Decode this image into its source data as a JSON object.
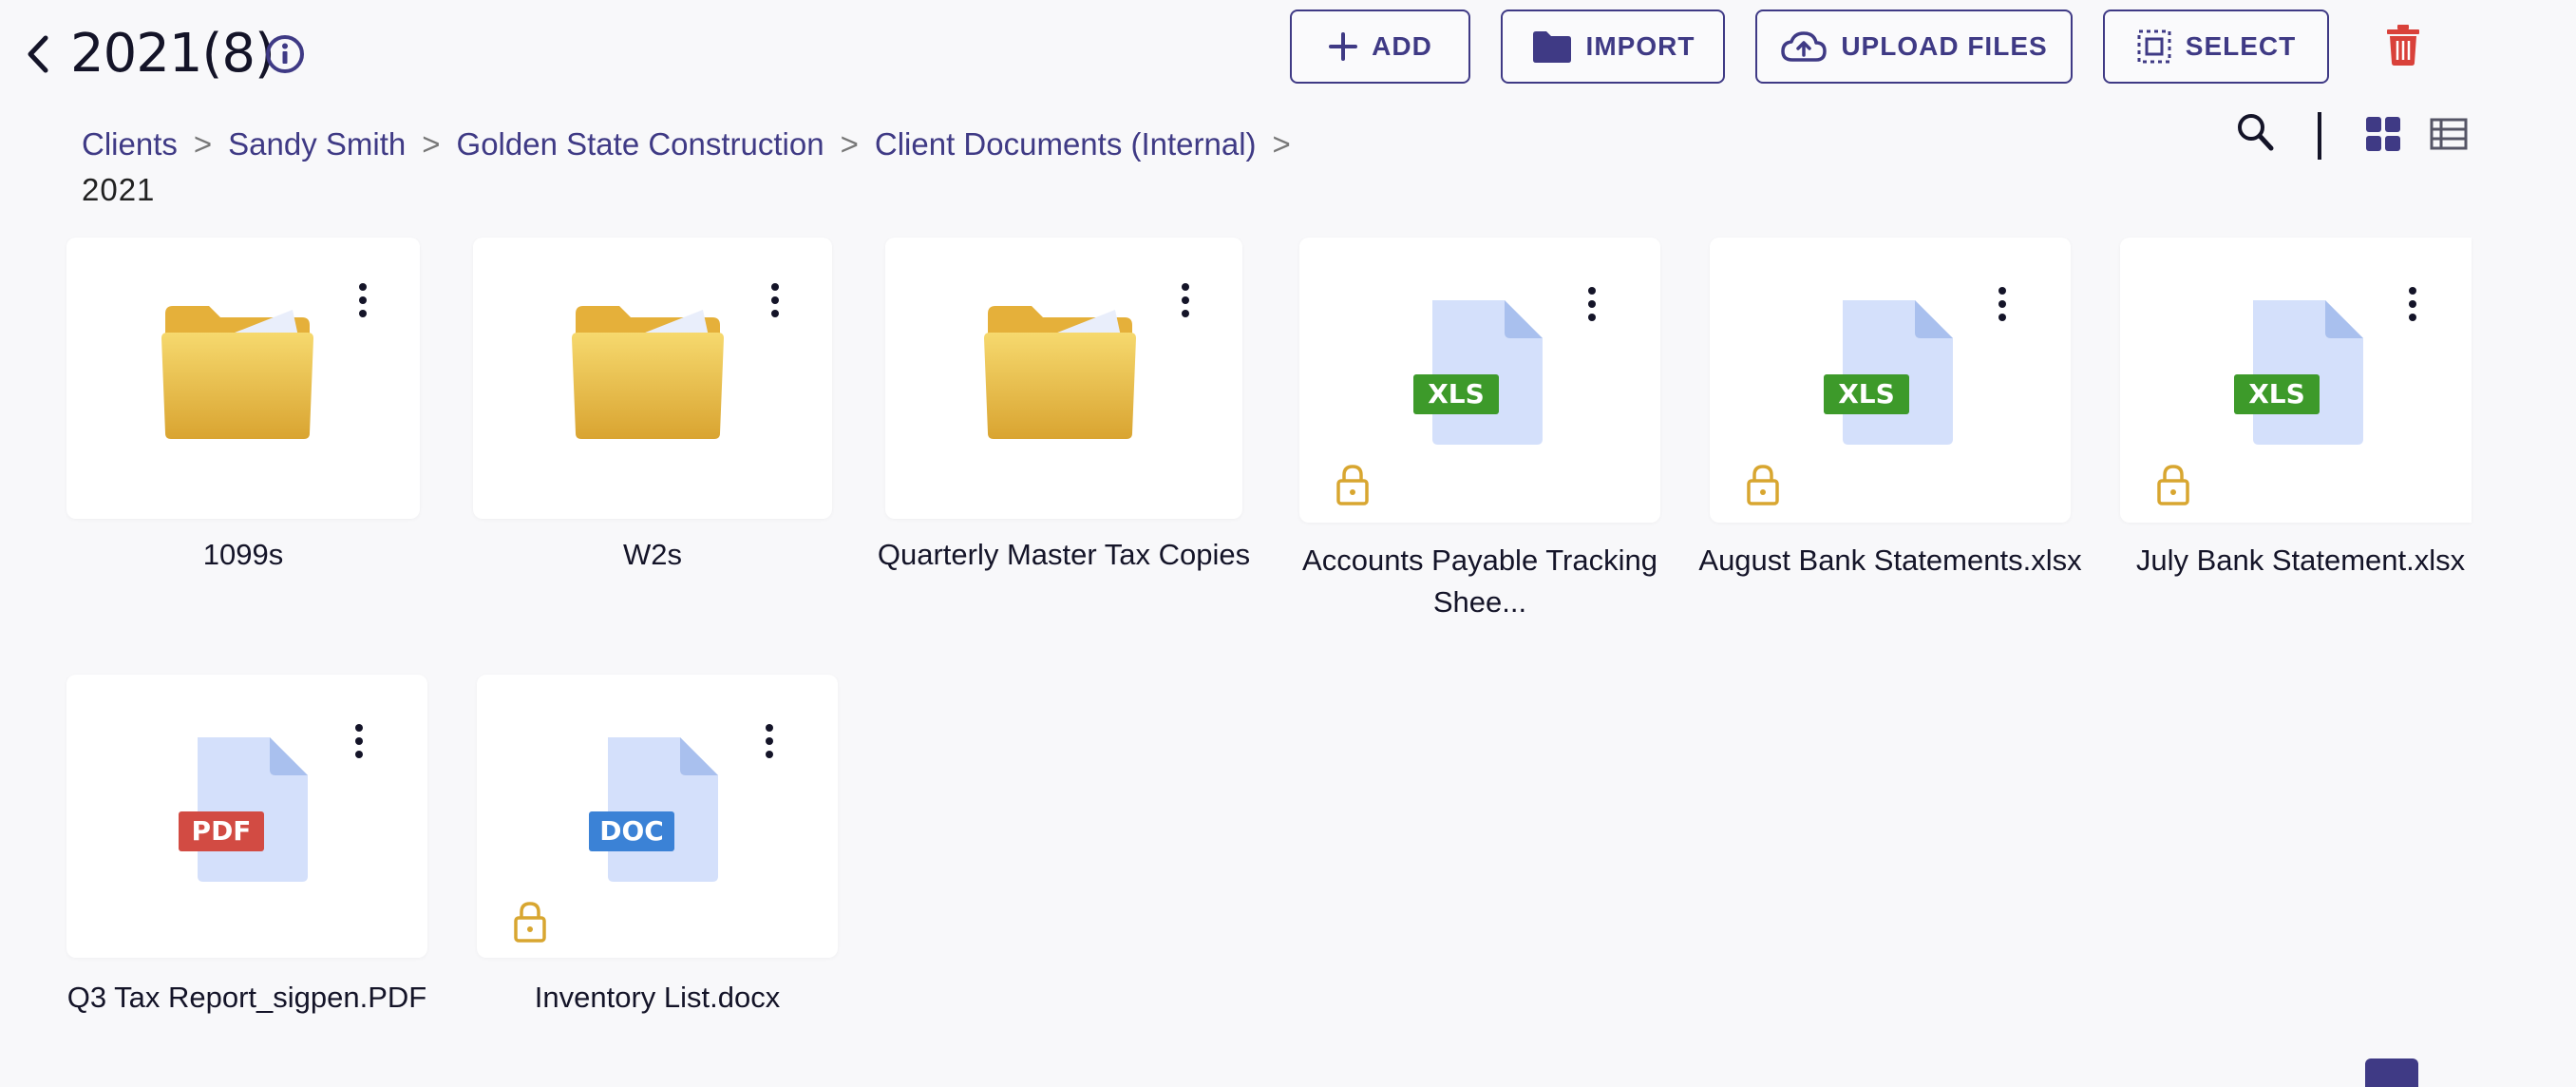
{
  "header": {
    "title": "2021(8)",
    "buttons": {
      "add": "ADD",
      "import": "IMPORT",
      "upload": "UPLOAD FILES",
      "select": "SELECT"
    }
  },
  "breadcrumb": {
    "items": [
      "Clients",
      "Sandy Smith",
      "Golden State Construction",
      "Client Documents (Internal)"
    ],
    "separator": ">",
    "current": "2021"
  },
  "items": [
    {
      "name": "1099s",
      "type": "folder"
    },
    {
      "name": "W2s",
      "type": "folder"
    },
    {
      "name": "Quarterly Master Tax Copies",
      "type": "folder"
    },
    {
      "name": "Accounts Payable Tracking Shee...",
      "type": "file",
      "badge": "XLS",
      "locked": true
    },
    {
      "name": "August Bank Statements.xlsx",
      "type": "file",
      "badge": "XLS",
      "locked": true
    },
    {
      "name": "July Bank Statement.xlsx",
      "type": "file",
      "badge": "XLS",
      "locked": true
    },
    {
      "name": "Q3 Tax Report_sigpen.PDF",
      "type": "file",
      "badge": "PDF",
      "locked": false
    },
    {
      "name": "Inventory List.docx",
      "type": "file",
      "badge": "DOC",
      "locked": true
    }
  ],
  "colors": {
    "accent": "#3f3a85",
    "folder": "#e8b53a",
    "xls_badge": "#3d9a2a",
    "pdf_badge": "#d24b43",
    "doc_badge": "#3b82d6",
    "lock": "#d8a630",
    "trash": "#d9413a"
  },
  "icons": {
    "back": "chevron-left-icon",
    "info": "info-icon",
    "add": "plus-icon",
    "import": "folder-icon",
    "upload": "cloud-upload-icon",
    "select": "select-icon",
    "delete": "trash-icon",
    "search": "search-icon",
    "grid": "grid-view-icon",
    "list": "list-view-icon"
  }
}
